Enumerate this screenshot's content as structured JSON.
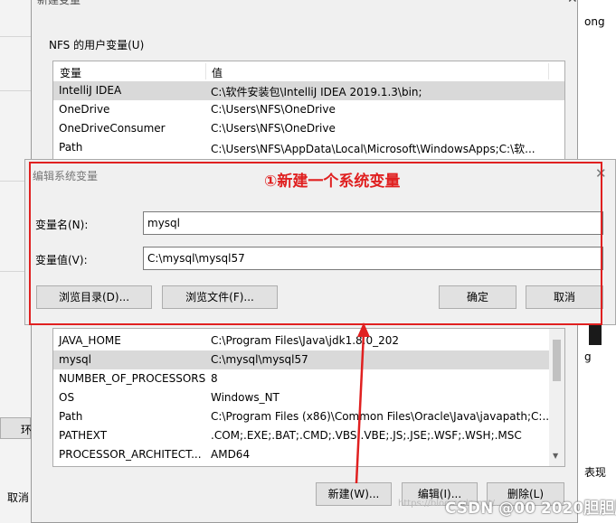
{
  "main_dialog": {
    "title": "新建变量",
    "close_glyph": "✕",
    "user_vars_label": "NFS 的用户变量(U)",
    "columns": [
      "变量",
      "值"
    ],
    "user_vars": [
      {
        "name": "IntelliJ IDEA",
        "value": "C:\\软件安装包\\IntelliJ IDEA 2019.1.3\\bin;"
      },
      {
        "name": "OneDrive",
        "value": "C:\\Users\\NFS\\OneDrive"
      },
      {
        "name": "OneDriveConsumer",
        "value": "C:\\Users\\NFS\\OneDrive"
      },
      {
        "name": "Path",
        "value": "C:\\Users\\NFS\\AppData\\Local\\Microsoft\\WindowsApps;C:\\软..."
      }
    ],
    "system_vars": [
      {
        "name": "JAVA_HOME",
        "value": "C:\\Program Files\\Java\\jdk1.8.0_202"
      },
      {
        "name": "mysql",
        "value": "C:\\mysql\\mysql57"
      },
      {
        "name": "NUMBER_OF_PROCESSORS",
        "value": "8"
      },
      {
        "name": "OS",
        "value": "Windows_NT"
      },
      {
        "name": "Path",
        "value": "C:\\Program Files (x86)\\Common Files\\Oracle\\Java\\javapath;C:..."
      },
      {
        "name": "PATHEXT",
        "value": ".COM;.EXE;.BAT;.CMD;.VBS;.VBE;.JS;.JSE;.WSF;.WSH;.MSC"
      },
      {
        "name": "PROCESSOR_ARCHITECT...",
        "value": "AMD64"
      }
    ],
    "new_button": "新建(W)...",
    "edit_button": "编辑(I)...",
    "delete_button": "删除(L)"
  },
  "edit_dialog": {
    "title": "编辑系统变量",
    "close_glyph": "✕",
    "name_label": "变量名(N):",
    "name_value": "mysql",
    "value_label": "变量值(V):",
    "value_value": "C:\\mysql\\mysql57",
    "browse_dir_button": "浏览目录(D)...",
    "browse_file_button": "浏览文件(F)...",
    "ok_button": "确定",
    "cancel_button": "取消"
  },
  "annotation": {
    "text": "①新建一个系统变量",
    "color": "#e02020"
  },
  "background": {
    "left_cancel": "取消",
    "left_btn": "环",
    "right_frag_1": "ong",
    "right_frag_2": "g",
    "right_frag_3": "表现"
  },
  "watermark": {
    "text": "https://blog.csdn.net/...",
    "csdn": "CSDN @00 2020胆胆胆"
  }
}
